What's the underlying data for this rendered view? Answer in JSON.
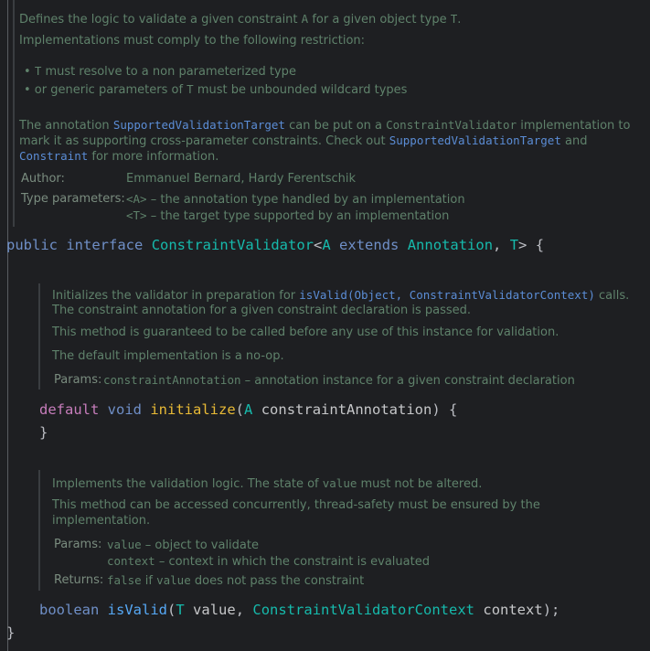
{
  "class_doc": {
    "line1_a": "Defines the logic to validate a given constraint ",
    "line1_code_a": "A",
    "line1_b": " for a given object type ",
    "line1_code_t": "T",
    "line1_c": ".",
    "line2": "Implementations must comply to the following restriction:",
    "bullet1_a": "• ",
    "bullet1_code": "T",
    "bullet1_b": " must resolve to a non parameterized type",
    "bullet2_a": "• or generic parameters of ",
    "bullet2_code": "T",
    "bullet2_b": " must be unbounded wildcard types",
    "para_a": "The annotation ",
    "para_link1": "SupportedValidationTarget",
    "para_b": " can be put on a ",
    "para_code1": "ConstraintValidator",
    "para_c": " implementation to",
    "para_line2_a": "mark it as supporting cross-parameter constraints. Check out ",
    "para_link2": "SupportedValidationTarget",
    "para_line2_b": " and",
    "para_link3": "Constraint",
    "para_line3": " for more information.",
    "author_label": "Author:",
    "author_value": "Emmanuel Bernard, Hardy Ferentschik",
    "typeparams_label": "Type parameters:",
    "tp1_code": "<A>",
    "tp1_text": " – the annotation type handled by an implementation",
    "tp2_code": "<T>",
    "tp2_text": " – the target type supported by an implementation"
  },
  "decl": {
    "public": "public",
    "interface": "interface",
    "name": "ConstraintValidator",
    "lt": "<",
    "A": "A",
    "extends": "extends",
    "annotation": "Annotation",
    "comma": ", ",
    "T": "T",
    "gt": "> {"
  },
  "init_doc": {
    "l1_a": "Initializes the validator in preparation for ",
    "l1_link": "isValid(Object, ConstraintValidatorContext)",
    "l1_b": " calls.",
    "l2": "The constraint annotation for a given constraint declaration is passed.",
    "l3": "This method is guaranteed to be called before any use of this instance for validation.",
    "l4": "The default implementation is a no-op.",
    "params_label": "Params:",
    "p1_code": "constraintAnnotation",
    "p1_text": " – annotation instance for a given constraint declaration"
  },
  "init_code": {
    "default": "default",
    "void": "void",
    "name": "initialize",
    "open": "(",
    "A": "A",
    "param": "constraintAnnotation",
    "close": ") {",
    "brace": "}"
  },
  "valid_doc": {
    "l1_a": "Implements the validation logic. The state of ",
    "l1_code": "value",
    "l1_b": " must not be altered.",
    "l2": "This method can be accessed concurrently, thread-safety must be ensured by the",
    "l3": "implementation.",
    "params_label": "Params:",
    "p1_code": "value",
    "p1_text": " – object to validate",
    "p2_code": "context",
    "p2_text": " – context in which the constraint is evaluated",
    "returns_label": "Returns:",
    "r_code1": "false",
    "r_mid": " if ",
    "r_code2": "value",
    "r_text": " does not pass the constraint"
  },
  "valid_code": {
    "boolean": "boolean",
    "name": "isValid",
    "open": "(",
    "T": "T",
    "p1": "value",
    "comma": ", ",
    "ctxtype": "ConstraintValidatorContext",
    "p2": "context",
    "close": ");"
  },
  "closing_brace": "}"
}
